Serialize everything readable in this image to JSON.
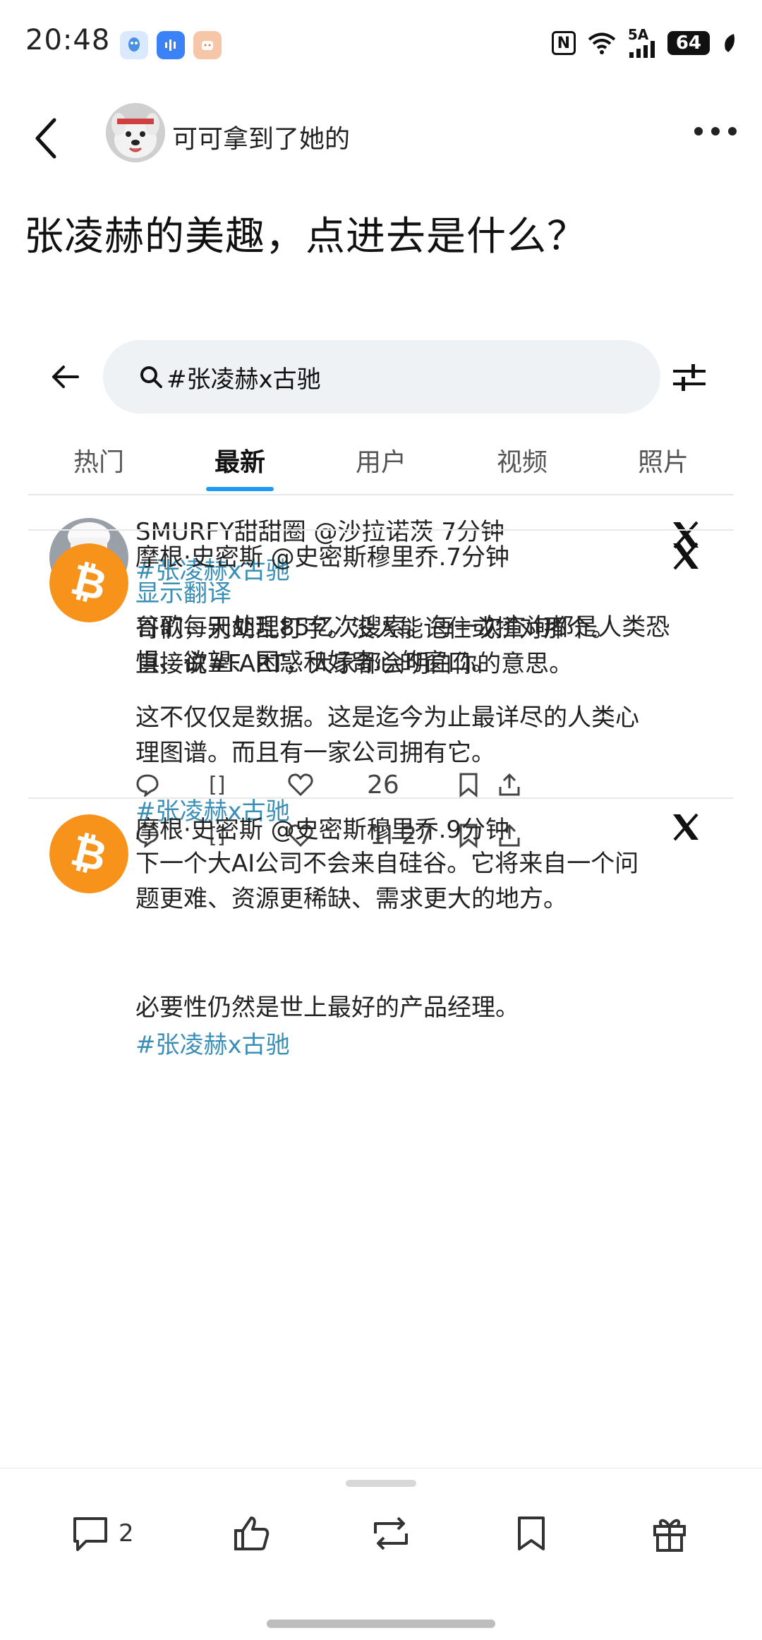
{
  "status": {
    "time": "20:48",
    "network": "5A",
    "battery": "64"
  },
  "header": {
    "poster_name": "可可拿到了她的"
  },
  "post": {
    "title": "张凌赫的美趣，点进去是什么？"
  },
  "x_app": {
    "search_query": "#张凌赫x古驰",
    "tabs": [
      "热门",
      "最新",
      "用户",
      "视频",
      "照片"
    ],
    "active_tab": "最新",
    "tweets": [
      {
        "header": "SMURFY甜甜圈 @沙拉诺茨 7分钟",
        "hashtag": "#张凌赫x古驰",
        "text_lines": [
          "哥们，别胡乱打字。没人能记住或拼对那个。",
          "直接说#FART，大家都会明白你的意思。"
        ],
        "views": "1l 27"
      },
      {
        "header": "摩根·史密斯 @史密斯穆里乔.7分钟",
        "translate": "显示翻译",
        "text_lines": [
          "谷歌每天处理85亿次搜索。每一次查询都是人类恐",
          "惧、欲望、困惑和好奇心的窗口。",
          "这不仅仅是数据。这是迄今为止最详尽的人类心",
          "理图谱。而且有一家公司拥有它。"
        ],
        "hashtag": "#张凌赫x古驰",
        "likes": "26"
      },
      {
        "header": "摩根·史密斯 @史密斯穆里乔.9分钟",
        "text_lines": [
          "下一个大AI公司不会来自硅谷。它将来自一个问",
          "题更难、资源更稀缺、需求更大的地方。",
          "必要性仍然是世上最好的产品经理。"
        ],
        "hashtag": "#张凌赫x古驰"
      }
    ]
  },
  "bottom_bar": {
    "comment_count": "2"
  },
  "colors": {
    "x_blue": "#1d9bf0",
    "hashtag": "#3a8fb7",
    "bitcoin": "#f7931a"
  }
}
